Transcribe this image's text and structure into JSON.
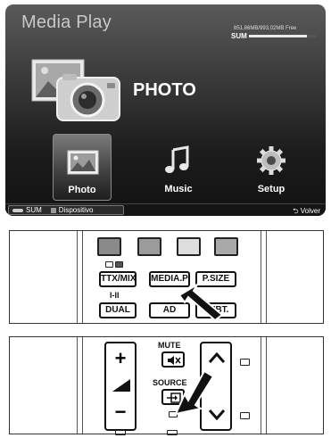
{
  "screen": {
    "app_title": "Media Play",
    "storage": {
      "label": "SUM",
      "info": "851,86MB/993,02MB Free",
      "used_fraction": 0.86
    },
    "section_title": "PHOTO",
    "menu": [
      {
        "label": "Photo",
        "icon": "photo-icon",
        "selected": true
      },
      {
        "label": "Music",
        "icon": "music-note-icon",
        "selected": false
      },
      {
        "label": "Setup",
        "icon": "gear-icon",
        "selected": false
      }
    ],
    "status_bar": {
      "sum_label": "SUM",
      "device_label": "Dispositivo",
      "back_label": "Volver"
    }
  },
  "remote_top": {
    "color_buttons": [
      "#8a8a8a",
      "#9b9b9b",
      "#dedede",
      "#a9a9a9"
    ],
    "buttons": {
      "ttx_mix": "TTX/MIX",
      "media_p": "MEDIA.P",
      "p_size": "P.SIZE",
      "dual": "DUAL",
      "ad": "AD",
      "subt": "SUBT.",
      "dual_top": "I-II"
    }
  },
  "remote_bottom": {
    "mute_label": "MUTE",
    "source_label": "SOURCE",
    "vol_plus": "+",
    "vol_minus": "−"
  }
}
